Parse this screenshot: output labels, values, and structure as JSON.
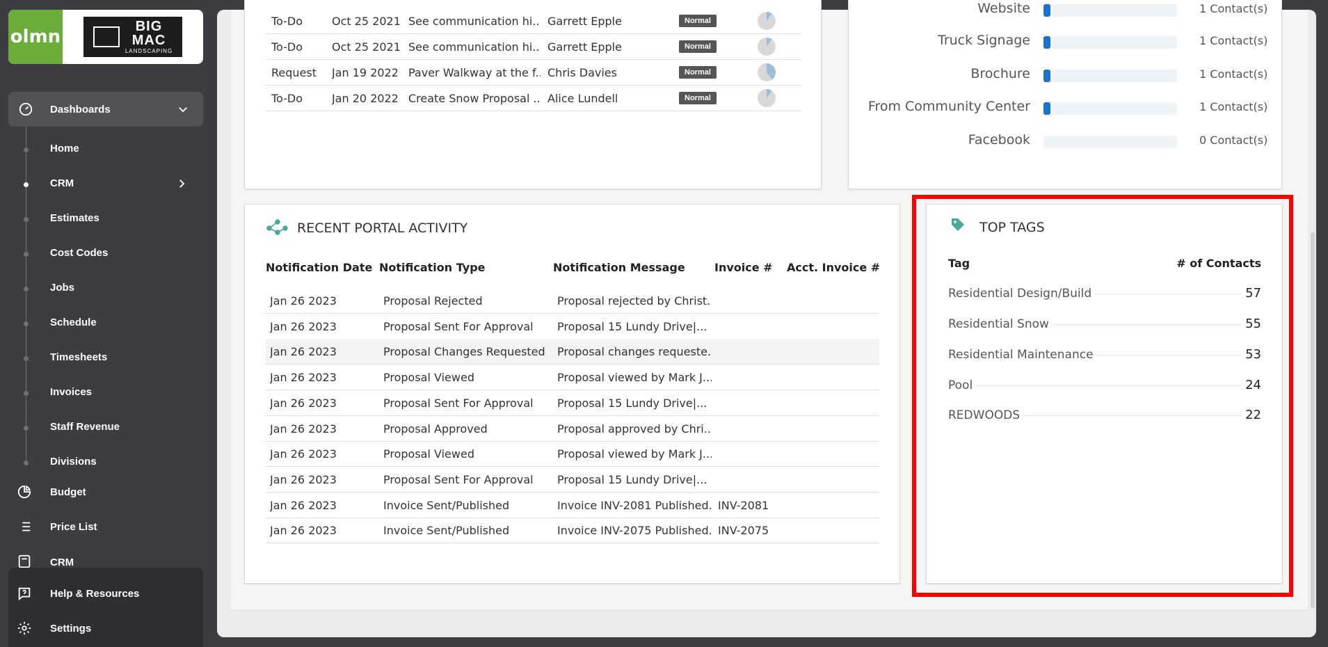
{
  "logo": {
    "app_short": "olmn",
    "brand_line1": "BIG",
    "brand_line2": "MAC",
    "brand_line3": "LANDSCAPING"
  },
  "sidebar": {
    "group": {
      "label": "Dashboards",
      "icon": "dashboard-gauge-icon",
      "expanded": true
    },
    "sub_items": [
      {
        "label": "Home"
      },
      {
        "label": "CRM",
        "active": true,
        "has_children": true
      },
      {
        "label": "Estimates"
      },
      {
        "label": "Cost Codes"
      },
      {
        "label": "Jobs"
      },
      {
        "label": "Schedule"
      },
      {
        "label": "Timesheets"
      },
      {
        "label": "Invoices"
      },
      {
        "label": "Staff Revenue"
      },
      {
        "label": "Divisions"
      }
    ],
    "main_items": [
      {
        "label": "Budget",
        "icon": "pie-chart-icon"
      },
      {
        "label": "Price List",
        "icon": "list-icon"
      },
      {
        "label": "CRM",
        "icon": "crm-icon"
      }
    ],
    "bottom_items": [
      {
        "label": "Help & Resources",
        "icon": "help-icon"
      },
      {
        "label": "Settings",
        "icon": "gear-icon"
      }
    ]
  },
  "tasks": {
    "rows": [
      {
        "type": "To-Do",
        "date": "Oct 25 2021",
        "subject": "See communication hi...",
        "assigned": "Garrett Epple",
        "priority": "Normal",
        "progress": 0.1
      },
      {
        "type": "To-Do",
        "date": "Oct 25 2021",
        "subject": "See communication hi...",
        "assigned": "Garrett Epple",
        "priority": "Normal",
        "progress": 0.1
      },
      {
        "type": "Request",
        "date": "Jan 19 2022",
        "subject": "Paver Walkway at the f...",
        "assigned": "Chris Davies",
        "priority": "Normal",
        "progress": 0.4
      },
      {
        "type": "To-Do",
        "date": "Jan 20 2022",
        "subject": "Create Snow Proposal ...",
        "assigned": "Alice Lundell",
        "priority": "Normal",
        "progress": 0.1
      }
    ]
  },
  "lead_sources": {
    "rows": [
      {
        "label": "Website",
        "count": "1 Contact(s)",
        "value": 1
      },
      {
        "label": "Truck Signage",
        "count": "1 Contact(s)",
        "value": 1
      },
      {
        "label": "Brochure",
        "count": "1 Contact(s)",
        "value": 1
      },
      {
        "label": "From Community Center",
        "count": "1 Contact(s)",
        "value": 1
      },
      {
        "label": "Facebook",
        "count": "0 Contact(s)",
        "value": 0
      }
    ]
  },
  "portal_activity": {
    "title": "RECENT PORTAL ACTIVITY",
    "icon": "network-nodes-icon",
    "headers": [
      "Notification Date",
      "Notification Type",
      "Notification Message",
      "Invoice #",
      "Acct. Invoice #"
    ],
    "rows": [
      {
        "date": "Jan 26 2023",
        "type": "Proposal Rejected",
        "message": "Proposal rejected by Christ...",
        "invoice": "",
        "acct_invoice": ""
      },
      {
        "date": "Jan 26 2023",
        "type": "Proposal Sent For Approval",
        "message": "Proposal 15 Lundy Drive|...",
        "invoice": "",
        "acct_invoice": ""
      },
      {
        "date": "Jan 26 2023",
        "type": "Proposal Changes Requested",
        "message": "Proposal changes requeste...",
        "invoice": "",
        "acct_invoice": "",
        "hover": true
      },
      {
        "date": "Jan 26 2023",
        "type": "Proposal Viewed",
        "message": "Proposal viewed by Mark J...",
        "invoice": "",
        "acct_invoice": ""
      },
      {
        "date": "Jan 26 2023",
        "type": "Proposal Sent For Approval",
        "message": "Proposal 15 Lundy Drive|...",
        "invoice": "",
        "acct_invoice": ""
      },
      {
        "date": "Jan 26 2023",
        "type": "Proposal Approved",
        "message": "Proposal approved by Chri...",
        "invoice": "",
        "acct_invoice": ""
      },
      {
        "date": "Jan 26 2023",
        "type": "Proposal Viewed",
        "message": "Proposal viewed by Mark J...",
        "invoice": "",
        "acct_invoice": ""
      },
      {
        "date": "Jan 26 2023",
        "type": "Proposal Sent For Approval",
        "message": "Proposal 15 Lundy Drive|...",
        "invoice": "",
        "acct_invoice": ""
      },
      {
        "date": "Jan 26 2023",
        "type": "Invoice Sent/Published",
        "message": "Invoice INV-2081 Published...",
        "invoice": "INV-2081",
        "acct_invoice": ""
      },
      {
        "date": "Jan 26 2023",
        "type": "Invoice Sent/Published",
        "message": "Invoice INV-2075 Published...",
        "invoice": "INV-2075",
        "acct_invoice": ""
      }
    ]
  },
  "top_tags": {
    "title": "TOP TAGS",
    "icon": "tag-icon",
    "header_tag": "Tag",
    "header_count": "# of Contacts",
    "rows": [
      {
        "tag": "Residential Design/Build",
        "count": "57"
      },
      {
        "tag": "Residential Snow",
        "count": "55"
      },
      {
        "tag": "Residential Maintenance",
        "count": "53"
      },
      {
        "tag": "Pool",
        "count": "24"
      },
      {
        "tag": "REDWOODS",
        "count": "22"
      }
    ]
  },
  "colors": {
    "accent_green": "#6aad3a",
    "bar_blue": "#1a73c7",
    "icon_teal": "#4ca89a",
    "highlight": "#ff0000"
  }
}
